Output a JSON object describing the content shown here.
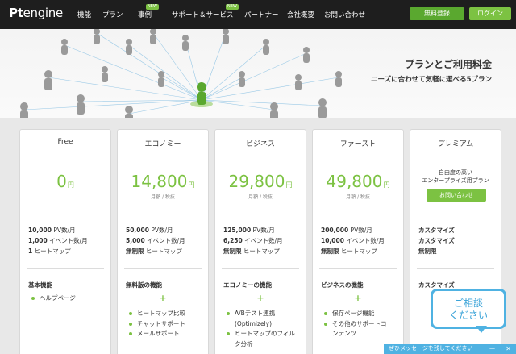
{
  "nav": {
    "logo_pt": "Pt",
    "logo_engine": "engine",
    "items": [
      "機能",
      "プラン",
      "事例",
      "サポート＆サービス",
      "パートナー",
      "会社概要",
      "お問い合わせ"
    ],
    "new_badge": "NEW",
    "register": "無料登録",
    "login": "ログイン"
  },
  "hero": {
    "title": "プランとご利用料金",
    "subtitle": "ニーズに合わせて気軽に選べる5プラン"
  },
  "plans": [
    {
      "name": "Free",
      "price": "0",
      "yen": "円",
      "note": "",
      "specs": [
        {
          "b": "10,000",
          "t": " PV数/月"
        },
        {
          "b": "1,000",
          "t": " イベント数/月"
        },
        {
          "b": "1",
          "t": " ヒートマップ"
        }
      ],
      "feature_title": "基本機能",
      "features": [
        "ヘルプページ"
      ]
    },
    {
      "name": "エコノミー",
      "price": "14,800",
      "yen": "円",
      "note": "月額 / 税抜",
      "specs": [
        {
          "b": "50,000",
          "t": " PV数/月"
        },
        {
          "b": "5,000",
          "t": " イベント数/月"
        },
        {
          "b": "無制限",
          "t": " ヒートマップ"
        }
      ],
      "feature_title": "無料版の機能",
      "plus": "+",
      "features": [
        "ヒートマップ比較",
        "チャットサポート",
        "メールサポート"
      ]
    },
    {
      "name": "ビジネス",
      "price": "29,800",
      "yen": "円",
      "note": "月額 / 税抜",
      "specs": [
        {
          "b": "125,000",
          "t": " PV数/月"
        },
        {
          "b": "6,250",
          "t": " イベント数/月"
        },
        {
          "b": "無制限",
          "t": " ヒートマップ"
        }
      ],
      "feature_title": "エコノミーの機能",
      "plus": "+",
      "features": [
        "A/Bテスト連携",
        "(Optimizely)",
        "ヒートマップのフィル",
        "タ分析"
      ]
    },
    {
      "name": "ファースト",
      "price": "49,800",
      "yen": "円",
      "note": "月額 / 税抜",
      "specs": [
        {
          "b": "200,000",
          "t": " PV数/月"
        },
        {
          "b": "10,000",
          "t": " イベント数/月"
        },
        {
          "b": "無制限",
          "t": " ヒートマップ"
        }
      ],
      "feature_title": "ビジネスの機能",
      "plus": "+",
      "features": [
        "保存ページ機能",
        "その他のサポートコ",
        "ンテンツ"
      ]
    },
    {
      "name": "プレミアム",
      "desc1": "自由度の高い",
      "desc2": "エンタープライズ用プラン",
      "contact_button": "お問い合わせ",
      "specs": [
        {
          "b": "カスタマイズ",
          "t": ""
        },
        {
          "b": "カスタマイズ",
          "t": ""
        },
        {
          "b": "無制限",
          "t": ""
        }
      ],
      "feature_title": "カスタマイズ"
    }
  ],
  "chat": {
    "bubble_line1": "ご相談",
    "bubble_line2": "ください",
    "bar_text": "ぜひメッセージを残してください",
    "min": "—",
    "close": "✕"
  }
}
